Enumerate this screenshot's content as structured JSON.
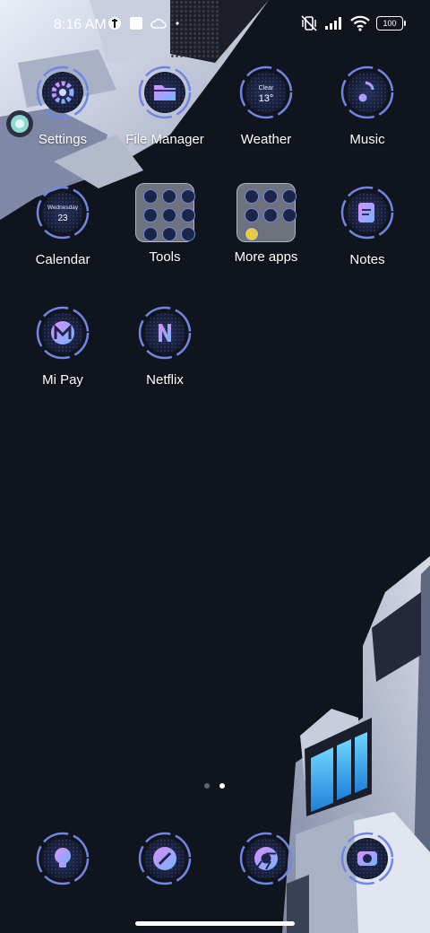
{
  "status_bar": {
    "time": "8:16 AM",
    "battery": "100",
    "icons": [
      "app-notification-icon",
      "square-notification-icon",
      "cloud-icon",
      "dot-icon",
      "vibrate-icon",
      "signal-icon",
      "wifi-icon",
      "battery-icon"
    ]
  },
  "home": {
    "apps": [
      {
        "label": "Settings",
        "icon": "gear-icon"
      },
      {
        "label": "File Manager",
        "icon": "folder-icon"
      },
      {
        "label": "Weather",
        "icon": "weather-icon",
        "condition": "Clear",
        "temp": "13°"
      },
      {
        "label": "Music",
        "icon": "music-note-icon"
      },
      {
        "label": "Calendar",
        "icon": "calendar-icon",
        "weekday": "Wednesday",
        "day": "23"
      },
      {
        "label": "Tools",
        "icon": "folder-tools"
      },
      {
        "label": "More apps",
        "icon": "folder-more-apps"
      },
      {
        "label": "Notes",
        "icon": "notes-icon"
      },
      {
        "label": "Mi Pay",
        "icon": "mi-pay-icon"
      },
      {
        "label": "Netflix",
        "icon": "netflix-icon"
      }
    ],
    "page_indicator": {
      "pages": 2,
      "current": 2
    }
  },
  "dock": {
    "apps": [
      {
        "icon": "lightbulb-icon"
      },
      {
        "icon": "pencil-icon"
      },
      {
        "icon": "chrome-icon"
      },
      {
        "icon": "camera-icon"
      }
    ]
  },
  "colors": {
    "background": "#10141c",
    "icon_glow": "#6f86e6",
    "icon_accent": "#c07ef0"
  }
}
